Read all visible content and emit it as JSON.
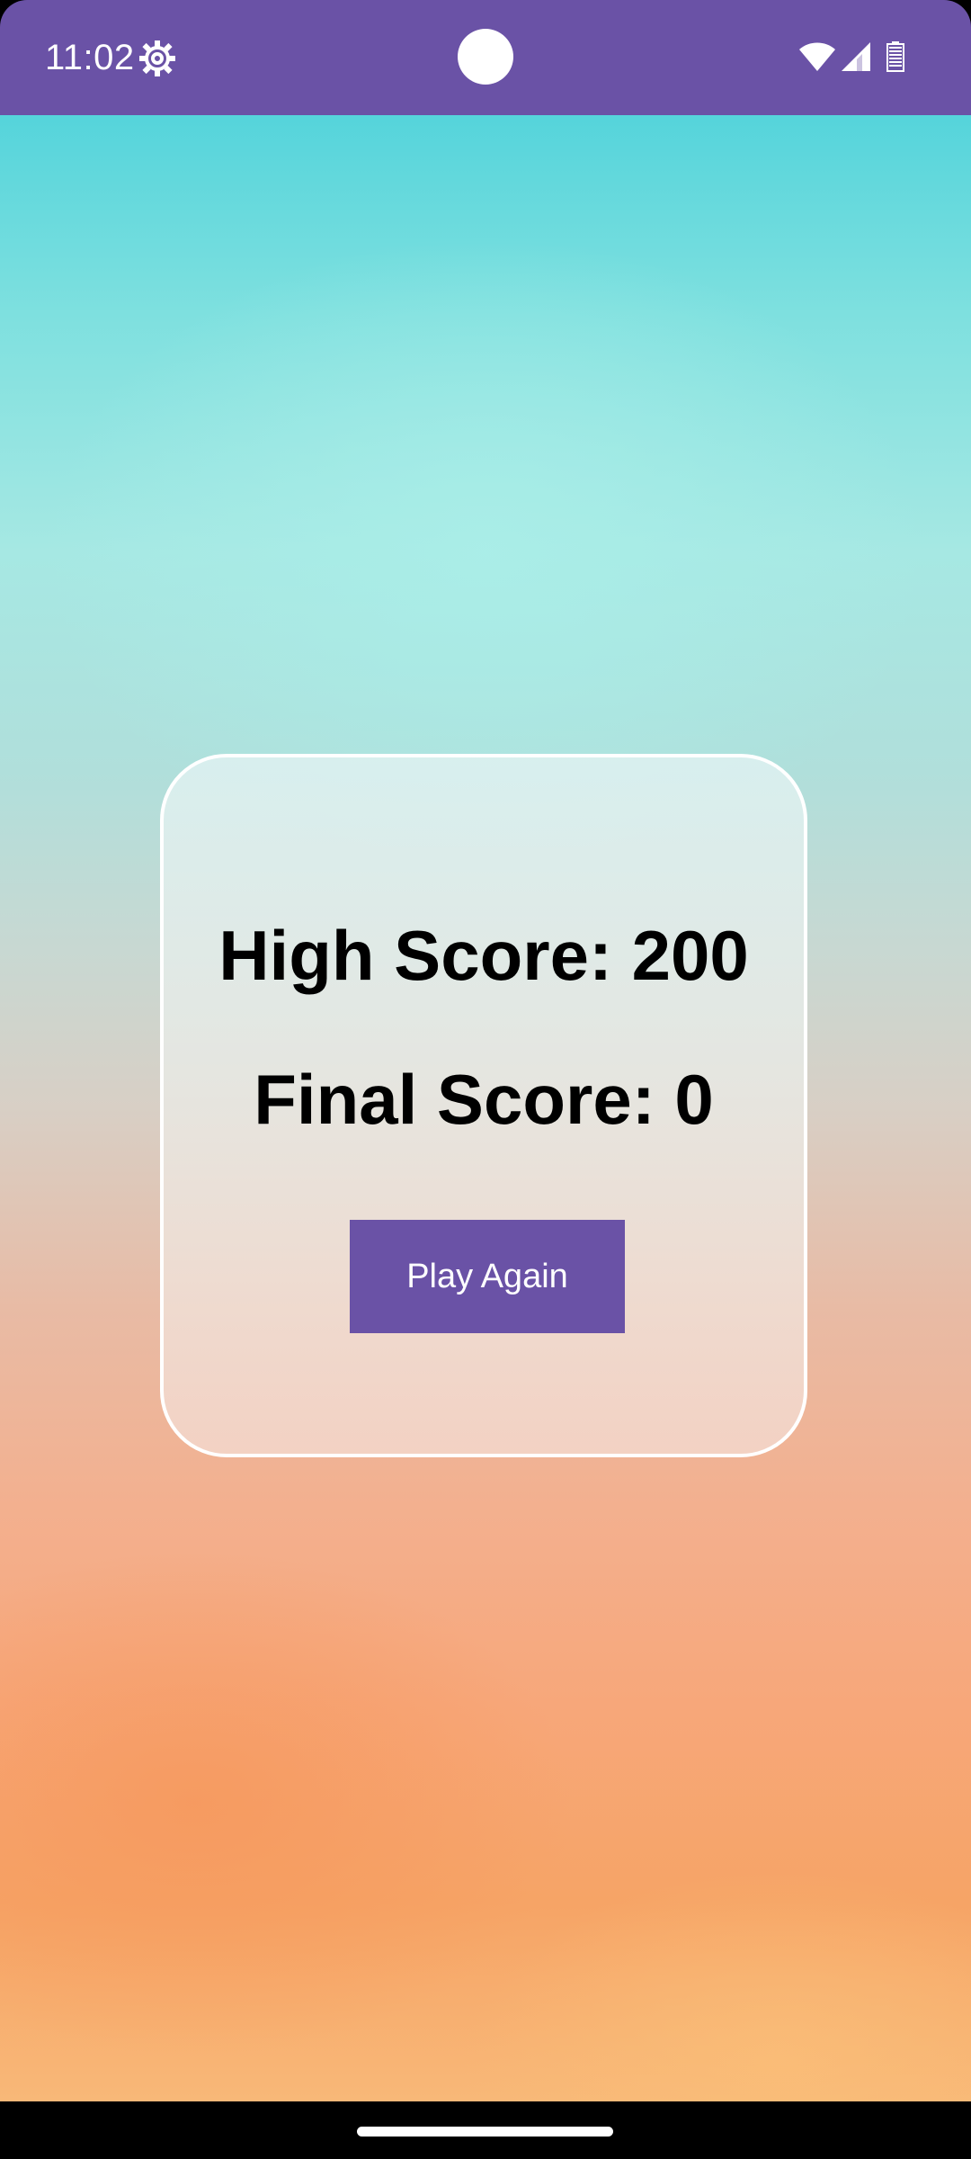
{
  "status_bar": {
    "time": "11:02",
    "background_color": "#6a52a6",
    "icons": [
      "settings-gear-icon",
      "wifi-icon",
      "cellular-signal-icon",
      "battery-icon"
    ]
  },
  "score_card": {
    "high_score_text": "High Score: 200",
    "final_score_text": "Final Score: 0",
    "play_again_label": "Play Again",
    "button_color": "#6a52a6"
  },
  "navigation": {
    "home_handle": "gesture-home-handle"
  }
}
